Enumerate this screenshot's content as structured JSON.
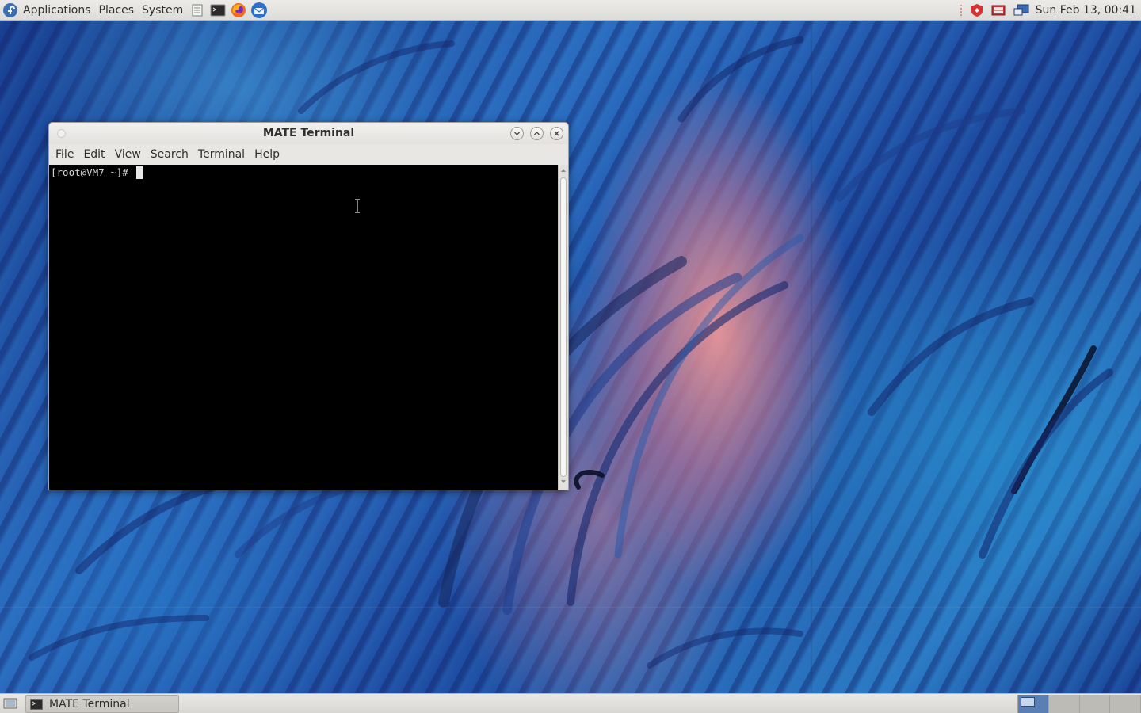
{
  "top_panel": {
    "menus": [
      "Applications",
      "Places",
      "System"
    ],
    "launchers": [
      "file-manager-icon",
      "terminal-icon",
      "firefox-icon",
      "thunderbird-icon"
    ],
    "tray": [
      "security-shield-icon",
      "network-icon",
      "display-icon"
    ],
    "clock": "Sun Feb 13, 00:41"
  },
  "window": {
    "title": "MATE Terminal",
    "menubar": [
      "File",
      "Edit",
      "View",
      "Search",
      "Terminal",
      "Help"
    ],
    "prompt": "[root@VM7 ~]# "
  },
  "bottom_panel": {
    "taskbar_item": "MATE Terminal",
    "workspaces": 4,
    "active_workspace": 1
  },
  "colors": {
    "terminal_bg": "#000000",
    "panel_bg": "#e4e2df",
    "workspace_active": "#5a7fb5"
  }
}
